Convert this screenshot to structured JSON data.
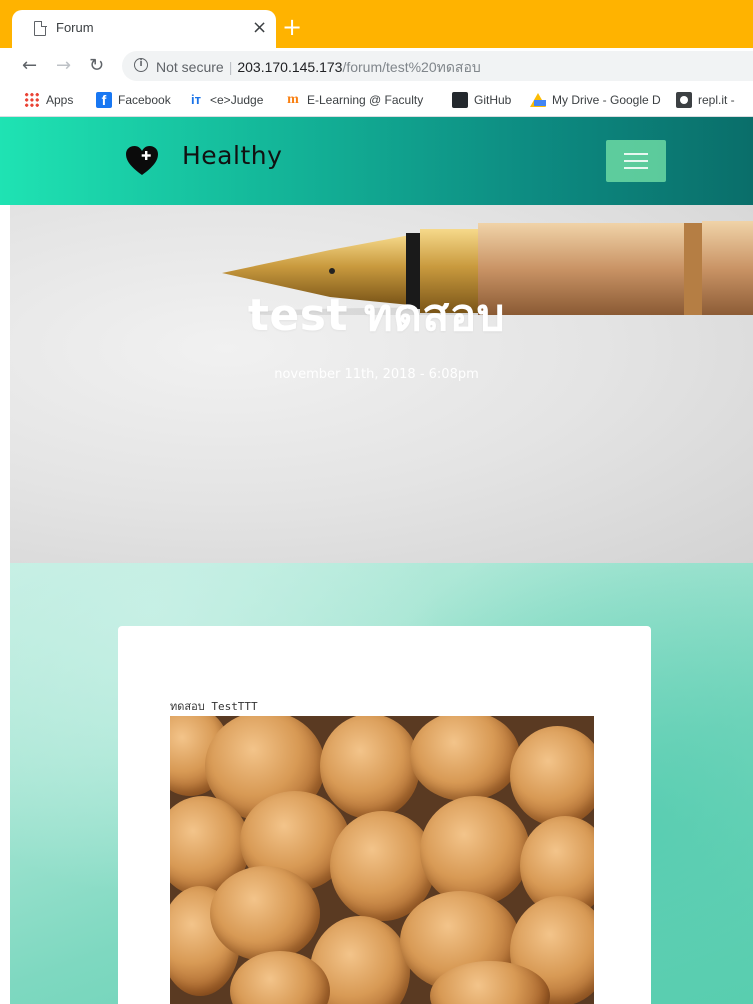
{
  "browser": {
    "tab_title": "Forum",
    "tab_close": "×",
    "new_tab": "+",
    "url_security": "Not secure",
    "url_host": "203.170.145.173",
    "url_path": "/forum/test%20ทดสอบ",
    "bookmarks": [
      {
        "label": "Apps",
        "icon": "apps-icon"
      },
      {
        "label": "Facebook",
        "icon": "facebook-icon"
      },
      {
        "label": "<e>Judge",
        "icon": "judge-icon"
      },
      {
        "label": "E-Learning @ Faculty",
        "icon": "moodle-icon"
      },
      {
        "label": "GitHub",
        "icon": "github-icon"
      },
      {
        "label": "My Drive - Google D",
        "icon": "drive-icon"
      },
      {
        "label": "repl.it -",
        "icon": "replit-icon"
      }
    ]
  },
  "site": {
    "brand": "Healthy"
  },
  "post": {
    "title": "test ทดสอบ",
    "date": "november 11th, 2018 - 6:08pm",
    "body": "ทดสอบ TestTTT"
  },
  "colors": {
    "tab_strip": "#ffb300",
    "header_start": "#1fe3b3",
    "header_end": "#0a6e6a"
  }
}
